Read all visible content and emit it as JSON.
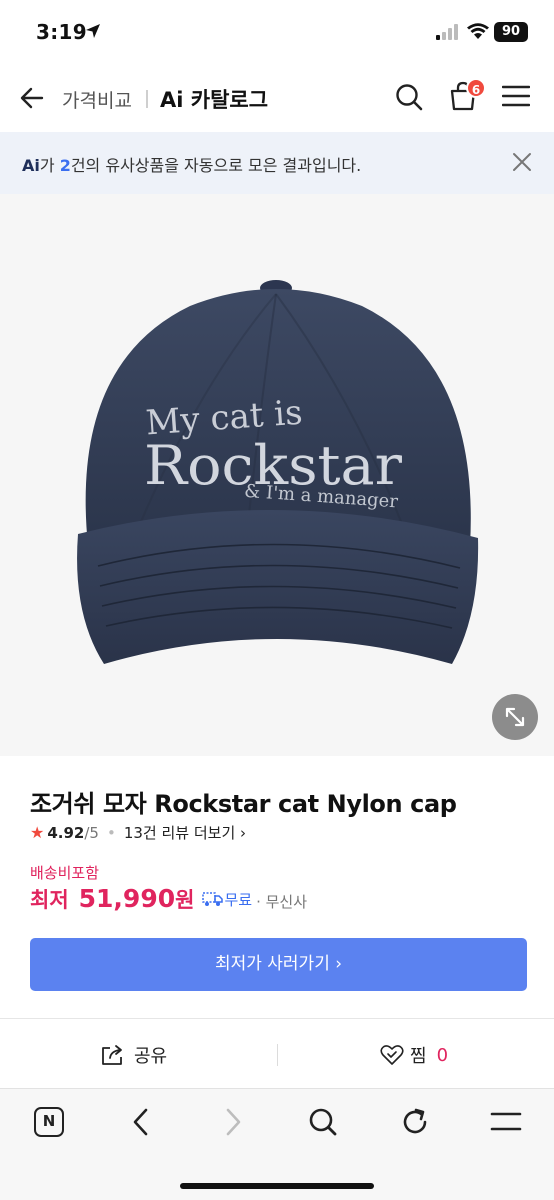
{
  "status_bar": {
    "time": "3:19",
    "battery": "90"
  },
  "header": {
    "breadcrumb_compare": "가격비교",
    "breadcrumb_catalog": "Ai 카탈로그",
    "cart_count": "6"
  },
  "notice": {
    "ai_label": "Ai",
    "text_before": "가 ",
    "count": "2",
    "text_after": "건의 유사상품을 자동으로 모은 결과입니다."
  },
  "product_image": {
    "cap_text_line1": "My cat is",
    "cap_text_line2": "Rockstar",
    "cap_text_line3": "& I'm a manager"
  },
  "product": {
    "title": "조거쉬 모자 Rockstar cat Nylon cap",
    "rating": "4.92",
    "rating_max": "/5",
    "review_link": "13건 리뷰 더보기 ›",
    "shipping_label": "배송비포함",
    "price_prefix": "최저",
    "price": "51,990",
    "price_unit": "원",
    "delivery": "무료",
    "mall": "· 무신사",
    "buy_label": "최저가 사러가기 ›"
  },
  "actions": {
    "share_label": "공유",
    "like_label": "찜",
    "like_count": "0"
  },
  "toolbar": {
    "n_label": "N"
  },
  "colors": {
    "price": "#e0245e",
    "primary_button": "#5b82f0",
    "notice_bg": "#eef2f9",
    "badge": "#f04a3e",
    "cap_navy": "#2f3a52"
  }
}
